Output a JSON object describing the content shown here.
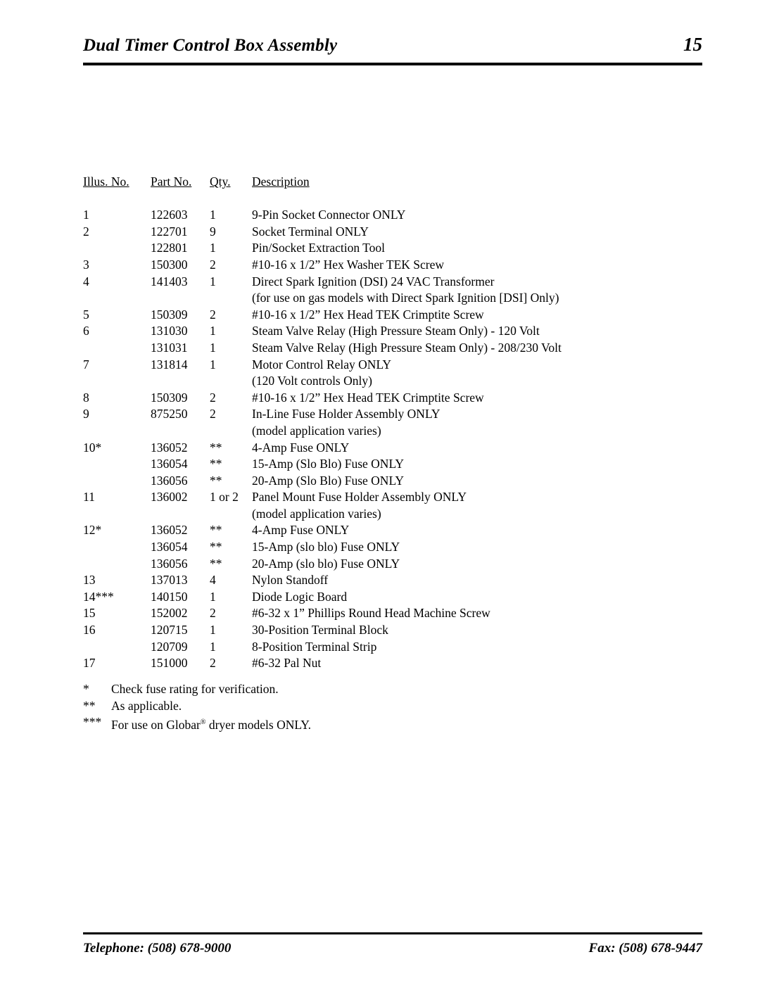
{
  "header": {
    "title": "Dual Timer Control Box Assembly",
    "page_number": "15"
  },
  "table": {
    "columns": [
      "Illus. No.",
      "Part No.",
      "Qty.",
      "Description"
    ],
    "rows": [
      {
        "illus": "1",
        "part": "122603",
        "qty": "1",
        "desc": "9-Pin Socket Connector ONLY"
      },
      {
        "illus": "2",
        "part": "122701",
        "qty": "9",
        "desc": "Socket Terminal ONLY"
      },
      {
        "illus": "",
        "part": "122801",
        "qty": "1",
        "desc": "Pin/Socket Extraction Tool"
      },
      {
        "illus": "3",
        "part": "150300",
        "qty": "2",
        "desc": "#10-16 x 1/2” Hex Washer TEK Screw"
      },
      {
        "illus": "4",
        "part": "141403",
        "qty": "1",
        "desc": "Direct Spark Ignition (DSI) 24 VAC Transformer"
      },
      {
        "illus": "",
        "part": "",
        "qty": "",
        "desc": "(for use on gas models with Direct Spark Ignition [DSI] Only)"
      },
      {
        "illus": "5",
        "part": "150309",
        "qty": "2",
        "desc": "#10-16 x 1/2” Hex Head TEK Crimptite Screw"
      },
      {
        "illus": "6",
        "part": "131030",
        "qty": "1",
        "desc": "Steam Valve Relay (High Pressure Steam Only) - 120 Volt"
      },
      {
        "illus": "",
        "part": "131031",
        "qty": "1",
        "desc": "Steam Valve Relay (High Pressure Steam Only) - 208/230 Volt"
      },
      {
        "illus": "7",
        "part": "131814",
        "qty": "1",
        "desc": "Motor Control Relay ONLY"
      },
      {
        "illus": "",
        "part": "",
        "qty": "",
        "desc": "(120 Volt controls Only)"
      },
      {
        "illus": "8",
        "part": "150309",
        "qty": "2",
        "desc": "#10-16 x 1/2” Hex Head TEK Crimptite Screw"
      },
      {
        "illus": "9",
        "part": "875250",
        "qty": "2",
        "desc": "In-Line Fuse Holder Assembly ONLY"
      },
      {
        "illus": "",
        "part": "",
        "qty": "",
        "desc": "(model application varies)"
      },
      {
        "illus": "10*",
        "part": "136052",
        "qty": "**",
        "desc": "4-Amp Fuse ONLY"
      },
      {
        "illus": "",
        "part": "136054",
        "qty": "**",
        "desc": "15-Amp (Slo Blo) Fuse ONLY"
      },
      {
        "illus": "",
        "part": "136056",
        "qty": "**",
        "desc": "20-Amp (Slo Blo) Fuse ONLY"
      },
      {
        "illus": "11",
        "part": "136002",
        "qty": "1 or 2",
        "desc": "Panel Mount Fuse Holder Assembly ONLY"
      },
      {
        "illus": "",
        "part": "",
        "qty": "",
        "desc": "(model application varies)"
      },
      {
        "illus": "12*",
        "part": "136052",
        "qty": "**",
        "desc": "4-Amp Fuse ONLY"
      },
      {
        "illus": "",
        "part": "136054",
        "qty": "**",
        "desc": "15-Amp (slo blo) Fuse ONLY"
      },
      {
        "illus": "",
        "part": "136056",
        "qty": "**",
        "desc": "20-Amp (slo blo) Fuse ONLY"
      },
      {
        "illus": "13",
        "part": "137013",
        "qty": "4",
        "desc": "Nylon Standoff"
      },
      {
        "illus": "14***",
        "part": "140150",
        "qty": "1",
        "desc": "Diode Logic Board"
      },
      {
        "illus": "15",
        "part": "152002",
        "qty": "2",
        "desc": "#6-32 x 1” Phillips Round Head Machine Screw"
      },
      {
        "illus": "16",
        "part": "120715",
        "qty": "1",
        "desc": "30-Position Terminal Block"
      },
      {
        "illus": "",
        "part": "120709",
        "qty": "1",
        "desc": "8-Position Terminal Strip"
      },
      {
        "illus": "17",
        "part": "151000",
        "qty": "2",
        "desc": "#6-32 Pal Nut"
      }
    ]
  },
  "notes": [
    {
      "mark": "*",
      "text": "Check fuse rating for verification."
    },
    {
      "mark": "**",
      "text": "As applicable."
    },
    {
      "mark": "***",
      "text_before": "For use on Globar",
      "text_after": " dryer models ONLY."
    }
  ],
  "footer": {
    "telephone": "Telephone: (508) 678-9000",
    "fax": "Fax: (508) 678-9447"
  }
}
